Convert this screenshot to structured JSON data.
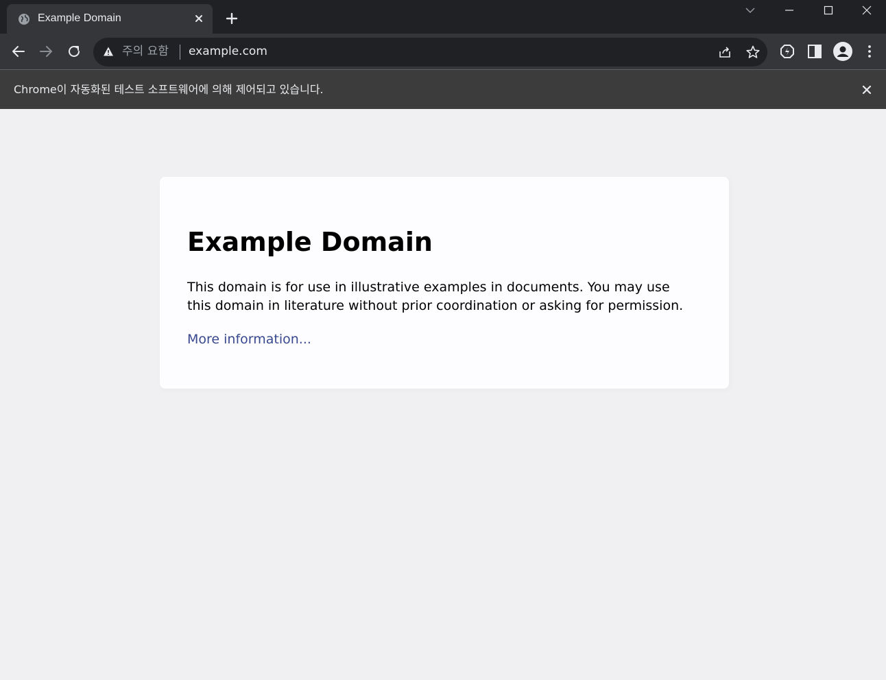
{
  "tab": {
    "title": "Example Domain",
    "favicon": "globe-icon"
  },
  "toolbar": {
    "security_label": "주의 요함",
    "url": "example.com"
  },
  "infobar": {
    "message": "Chrome이 자동화된 테스트 소프트웨어에 의해 제어되고 있습니다."
  },
  "page": {
    "heading": "Example Domain",
    "body": "This domain is for use in illustrative examples in documents. You may use this domain in literature without prior coordination or asking for permission.",
    "link": "More information..."
  },
  "colors": {
    "tabstrip_bg": "#202124",
    "toolbar_bg": "#35363a",
    "page_bg": "#f0f0f2",
    "link": "#38488f"
  }
}
